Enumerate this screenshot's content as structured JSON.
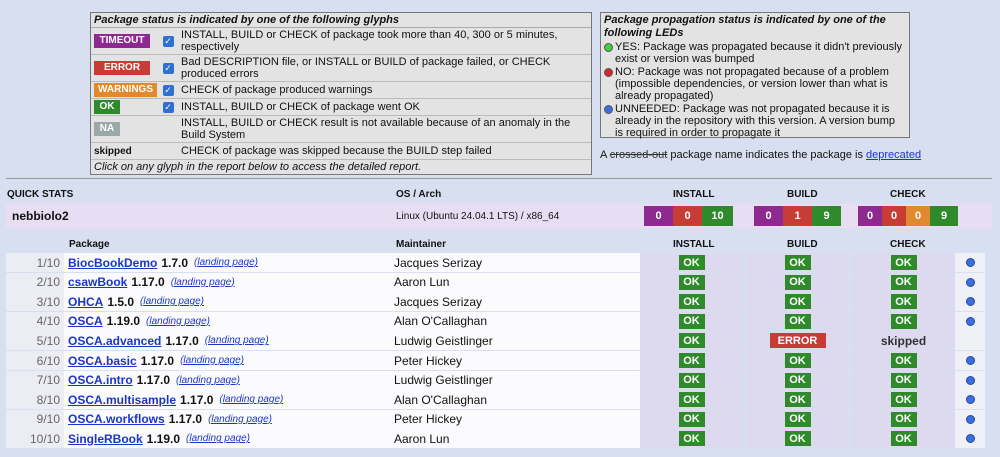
{
  "legend": {
    "title": "Package status is indicated by one of the following glyphs",
    "rows": [
      {
        "glyph": "TIMEOUT",
        "checked": true,
        "desc": "INSTALL, BUILD or CHECK of package took more than 40, 300 or 5 minutes, respectively"
      },
      {
        "glyph": "ERROR",
        "checked": true,
        "desc": "Bad DESCRIPTION file, or INSTALL or BUILD of package failed, or CHECK produced errors"
      },
      {
        "glyph": "WARNINGS",
        "checked": true,
        "desc": "CHECK of package produced warnings"
      },
      {
        "glyph": "OK",
        "checked": true,
        "desc": "INSTALL, BUILD or CHECK of package went OK"
      },
      {
        "glyph": "NA",
        "checked": false,
        "desc": "INSTALL, BUILD or CHECK result is not available because of an anomaly in the Build System"
      },
      {
        "glyph": "skipped",
        "checked": false,
        "desc": "CHECK of package was skipped because the BUILD step failed"
      }
    ],
    "footer": "Click on any glyph in the report below to access the detailed report."
  },
  "propagation": {
    "title": "Package propagation status is indicated by one of the following LEDs",
    "items": [
      {
        "led": "green",
        "text": "YES: Package was propagated because it didn't previously exist or version was bumped"
      },
      {
        "led": "red",
        "text": "NO: Package was not propagated because of a problem (impossible dependencies, or version lower than what is already propagated)"
      },
      {
        "led": "blue",
        "text": "UNNEEDED: Package was not propagated because it is already in the repository with this version. A version bump is required in order to propagate it"
      }
    ]
  },
  "deprecated": {
    "prefix": "A",
    "crossed": "crossed-out",
    "middle": "package name indicates the package is",
    "link": "deprecated"
  },
  "quick_stats": {
    "label": "QUICK STATS",
    "os_header": "OS / Arch",
    "install_header": "INSTALL",
    "build_header": "BUILD",
    "check_header": "CHECK",
    "node": "nebbiolo2",
    "os": "Linux (Ubuntu 24.04.1 LTS) / x86_64",
    "install": [
      "0",
      "0",
      "10"
    ],
    "build": [
      "0",
      "1",
      "9"
    ],
    "check": [
      "0",
      "0",
      "0",
      "9"
    ]
  },
  "table": {
    "headers": {
      "package": "Package",
      "maintainer": "Maintainer",
      "install": "INSTALL",
      "build": "BUILD",
      "check": "CHECK"
    },
    "landing_label": "(landing page)",
    "rows": [
      {
        "idx": "1/10",
        "name": "BiocBookDemo",
        "version": "1.7.0",
        "maintainer": "Jacques Serizay",
        "install": "OK",
        "build": "OK",
        "check": "OK",
        "led": true
      },
      {
        "idx": "2/10",
        "name": "csawBook",
        "version": "1.17.0",
        "maintainer": "Aaron Lun",
        "install": "OK",
        "build": "OK",
        "check": "OK",
        "led": true
      },
      {
        "idx": "3/10",
        "name": "OHCA",
        "version": "1.5.0",
        "maintainer": "Jacques Serizay",
        "install": "OK",
        "build": "OK",
        "check": "OK",
        "led": true
      },
      {
        "idx": "4/10",
        "name": "OSCA",
        "version": "1.19.0",
        "maintainer": "Alan O'Callaghan",
        "install": "OK",
        "build": "OK",
        "check": "OK",
        "led": true
      },
      {
        "idx": "5/10",
        "name": "OSCA.advanced",
        "version": "1.17.0",
        "maintainer": "Ludwig Geistlinger",
        "install": "OK",
        "build": "ERROR",
        "check": "skipped",
        "led": false
      },
      {
        "idx": "6/10",
        "name": "OSCA.basic",
        "version": "1.17.0",
        "maintainer": "Peter Hickey",
        "install": "OK",
        "build": "OK",
        "check": "OK",
        "led": true
      },
      {
        "idx": "7/10",
        "name": "OSCA.intro",
        "version": "1.17.0",
        "maintainer": "Ludwig Geistlinger",
        "install": "OK",
        "build": "OK",
        "check": "OK",
        "led": true
      },
      {
        "idx": "8/10",
        "name": "OSCA.multisample",
        "version": "1.17.0",
        "maintainer": "Alan O'Callaghan",
        "install": "OK",
        "build": "OK",
        "check": "OK",
        "led": true
      },
      {
        "idx": "9/10",
        "name": "OSCA.workflows",
        "version": "1.17.0",
        "maintainer": "Peter Hickey",
        "install": "OK",
        "build": "OK",
        "check": "OK",
        "led": true
      },
      {
        "idx": "10/10",
        "name": "SingleRBook",
        "version": "1.19.0",
        "maintainer": "Aaron Lun",
        "install": "OK",
        "build": "OK",
        "check": "OK",
        "led": true
      }
    ]
  }
}
